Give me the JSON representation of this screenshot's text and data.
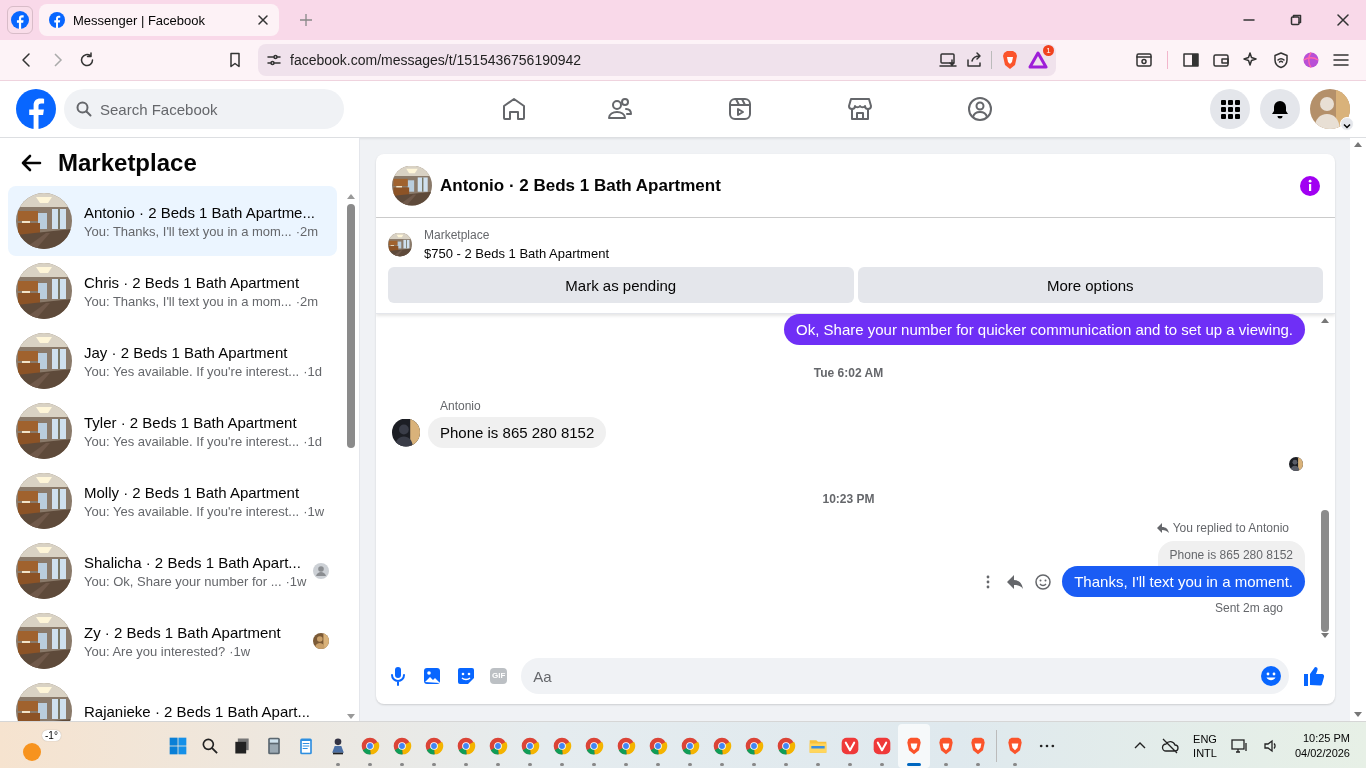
{
  "browser": {
    "tab_title": "Messenger | Facebook",
    "url": "facebook.com/messages/t/1515436756190942",
    "alert_badge": "1"
  },
  "header": {
    "search_placeholder": "Search Facebook",
    "nav": [
      {
        "kind": "home"
      },
      {
        "kind": "friends"
      },
      {
        "kind": "video"
      },
      {
        "kind": "marketplace"
      },
      {
        "kind": "groups"
      }
    ]
  },
  "sidebar": {
    "title": "Marketplace",
    "conversations": [
      {
        "name": "Antonio · 2 Beds 1 Bath Apartme...",
        "preview": "You: Thanks, I'll text you in a mom...",
        "time": "·2m",
        "selected": true
      },
      {
        "name": "Chris · 2 Beds 1 Bath Apartment",
        "preview": "You: Thanks, I'll text you in a mom...",
        "time": "·2m",
        "selected": false
      },
      {
        "name": "Jay · 2 Beds 1 Bath Apartment",
        "preview": "You: Yes available. If you're interest...",
        "time": "·1d",
        "selected": false
      },
      {
        "name": "Tyler · 2 Beds 1 Bath Apartment",
        "preview": "You: Yes available. If you're interest...",
        "time": "·1d",
        "selected": false
      },
      {
        "name": "Molly · 2 Beds 1 Bath Apartment",
        "preview": "You: Yes available. If you're interest...",
        "time": "·1w",
        "selected": false
      },
      {
        "name": "Shalicha · 2 Beds 1 Bath Apart...",
        "preview": "You: Ok, Share your number for ...",
        "time": "·1w",
        "selected": false,
        "seen": {
          "kind": "default-avatar"
        }
      },
      {
        "name": "Zy · 2 Beds 1 Bath Apartment",
        "preview": "You: Are you interested?",
        "time": "·1w",
        "selected": false,
        "seen": {
          "kind": "photo-avatar"
        }
      },
      {
        "name": "Rajanieke · 2 Beds 1 Bath Apart...",
        "selected": false
      }
    ]
  },
  "chat": {
    "title": "Antonio · 2 Beds 1 Bath Apartment",
    "listing": {
      "label": "Marketplace",
      "title": "$750 - 2 Beds 1 Bath Apartment",
      "buttons": [
        "Mark as pending",
        "More options"
      ]
    },
    "messages": [
      {
        "kind": "outgoing",
        "text": "Ok, Share your number for quicker communication and to set up a viewing.",
        "color": "#6f2ff6"
      },
      {
        "kind": "timestamp",
        "text": "Tue 6:02 AM"
      },
      {
        "kind": "incoming",
        "sender": "Antonio",
        "text": "Phone is 865 280 8152"
      },
      {
        "kind": "seen"
      },
      {
        "kind": "timestamp",
        "text": "10:23 PM"
      },
      {
        "kind": "reply",
        "note": "You replied to Antonio",
        "quote": "Phone is 865 280 8152",
        "text": "Thanks, I'll text you in a moment.",
        "color": "#1a5cf4",
        "status": "Sent 2m ago"
      }
    ],
    "composer": {
      "gif_label": "GIF",
      "placeholder": "Aa"
    }
  },
  "taskbar": {
    "weather": "-1°",
    "apps": [
      {
        "kind": "start",
        "running": false
      },
      {
        "kind": "search",
        "running": false
      },
      {
        "kind": "taskview",
        "running": false
      },
      {
        "kind": "calculator",
        "running": false
      },
      {
        "kind": "notepad",
        "running": false
      },
      {
        "kind": "figure",
        "running": true
      },
      {
        "kind": "chrome",
        "running": true
      },
      {
        "kind": "chrome",
        "running": true
      },
      {
        "kind": "chrome",
        "running": true
      },
      {
        "kind": "chrome",
        "running": true
      },
      {
        "kind": "chrome",
        "running": true
      },
      {
        "kind": "chrome",
        "running": true
      },
      {
        "kind": "chrome",
        "running": true
      },
      {
        "kind": "chrome",
        "running": true
      },
      {
        "kind": "chrome",
        "running": true
      },
      {
        "kind": "chrome",
        "running": true
      },
      {
        "kind": "chrome",
        "running": true
      },
      {
        "kind": "chrome",
        "running": true
      },
      {
        "kind": "chrome",
        "running": true
      },
      {
        "kind": "chrome",
        "running": true
      },
      {
        "kind": "folder",
        "running": true
      },
      {
        "kind": "vivaldi",
        "running": true
      },
      {
        "kind": "vivaldi",
        "running": true
      },
      {
        "kind": "brave",
        "running": true,
        "selected": true
      },
      {
        "kind": "brave",
        "running": true
      },
      {
        "kind": "brave",
        "running": true
      },
      {
        "kind": "divider"
      },
      {
        "kind": "brave",
        "running": true
      },
      {
        "kind": "more",
        "running": false
      }
    ],
    "language": [
      "ENG",
      "INTL"
    ],
    "time": "10:25 PM",
    "date": "04/02/2026"
  }
}
